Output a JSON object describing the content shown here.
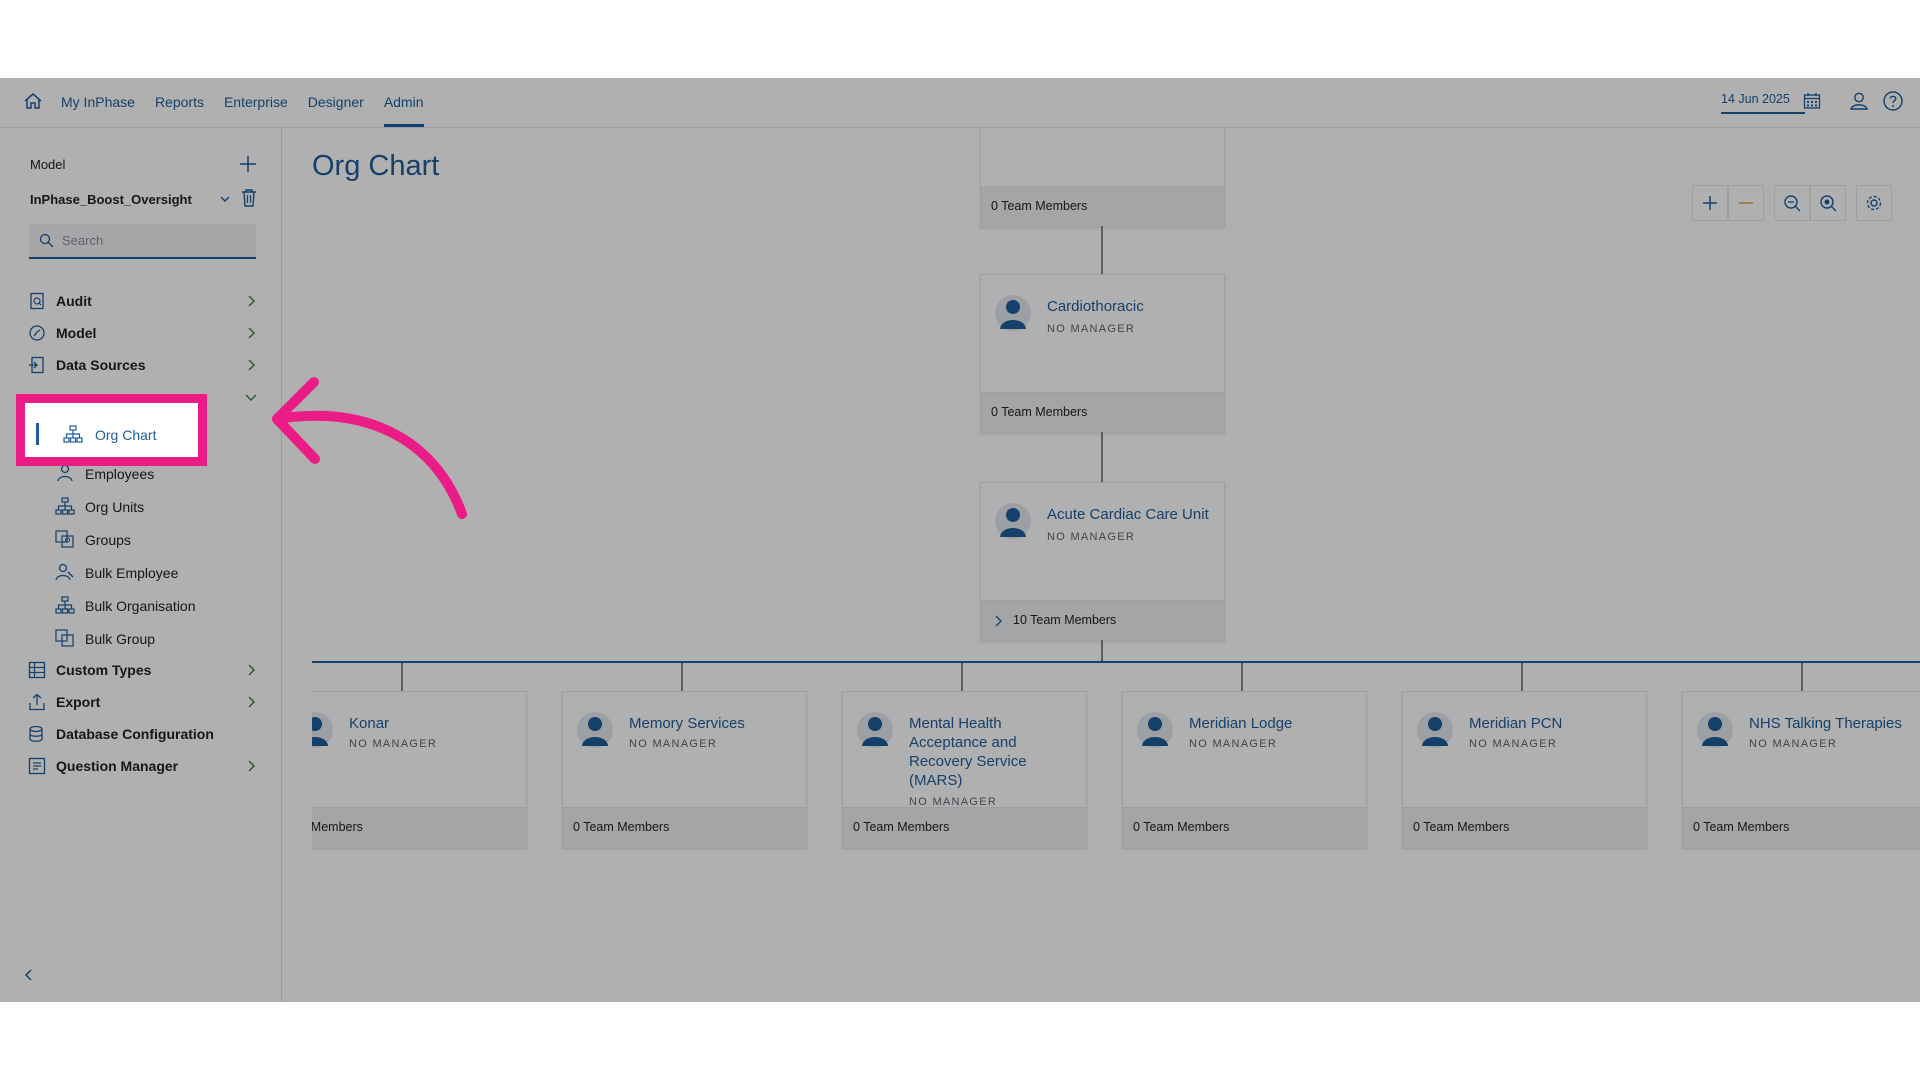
{
  "nav": {
    "items": [
      "My InPhase",
      "Reports",
      "Enterprise",
      "Designer",
      "Admin"
    ],
    "active": "Admin",
    "date": "14 Jun 2025"
  },
  "sidebar": {
    "model_label": "Model",
    "model_value": "InPhase_Boost_Oversight",
    "search_placeholder": "Search",
    "menu": [
      {
        "label": "Audit",
        "icon": "audit-icon"
      },
      {
        "label": "Model",
        "icon": "model-icon"
      },
      {
        "label": "Data Sources",
        "icon": "data-sources-icon"
      },
      {
        "label": "Custom Types",
        "icon": "custom-types-icon"
      },
      {
        "label": "Export",
        "icon": "export-icon"
      },
      {
        "label": "Database Configuration",
        "icon": "database-icon"
      },
      {
        "label": "Question Manager",
        "icon": "question-manager-icon"
      }
    ],
    "submenu": [
      {
        "label": "Org Chart",
        "icon": "org-chart-icon"
      },
      {
        "label": "Employees",
        "icon": "employees-icon"
      },
      {
        "label": "Org Units",
        "icon": "org-units-icon"
      },
      {
        "label": "Groups",
        "icon": "groups-icon"
      },
      {
        "label": "Bulk Employee",
        "icon": "bulk-employee-icon"
      },
      {
        "label": "Bulk Organisation",
        "icon": "bulk-organisation-icon"
      },
      {
        "label": "Bulk Group",
        "icon": "bulk-group-icon"
      }
    ]
  },
  "main": {
    "title": "Org Chart",
    "top_card_footer": "0 Team Members",
    "chain": [
      {
        "name": "Cardiothoracic",
        "manager": "NO MANAGER",
        "footer": "0 Team Members"
      },
      {
        "name": "Acute Cardiac Care Unit",
        "manager": "NO MANAGER",
        "footer": "10 Team Members"
      }
    ],
    "children": [
      {
        "name": "Konar",
        "manager": "NO MANAGER",
        "footer": "eam Members"
      },
      {
        "name": "Memory Services",
        "manager": "NO MANAGER",
        "footer": "0 Team Members"
      },
      {
        "name": "Mental Health Acceptance and Recovery Service (MARS)",
        "manager": "NO MANAGER",
        "footer": "0 Team Members"
      },
      {
        "name": "Meridian Lodge",
        "manager": "NO MANAGER",
        "footer": "0 Team Members"
      },
      {
        "name": "Meridian PCN",
        "manager": "NO MANAGER",
        "footer": "0 Team Members"
      },
      {
        "name": "NHS Talking Therapies",
        "manager": "NO MANAGER",
        "footer": "0 Team Members"
      }
    ]
  },
  "colors": {
    "accent": "#1f5d99",
    "highlight": "#ec1c86",
    "overlay": "rgba(0,0,0,0.31)"
  }
}
